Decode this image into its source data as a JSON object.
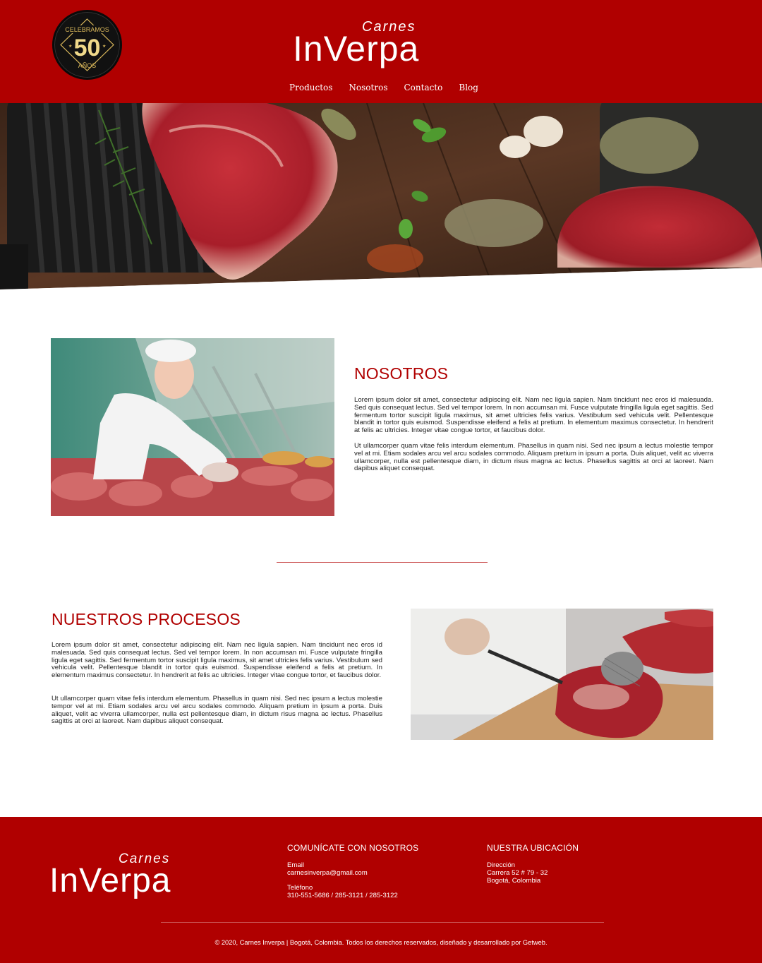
{
  "colors": {
    "brand_red": "#b00000",
    "white": "#ffffff",
    "gold": "#d8b65a"
  },
  "header": {
    "badge": {
      "top_text": "CELEBRAMOS",
      "number": "50",
      "bottom_text": "AÑOS"
    },
    "logo": {
      "small": "Carnes",
      "big": "InVerpa"
    },
    "nav": [
      "Productos",
      "Nosotros",
      "Contacto",
      "Blog"
    ]
  },
  "hero": {
    "image": "hero-meat-board-image"
  },
  "nosotros": {
    "title": "NOSOTROS",
    "image": "butcher-woman-counter-image",
    "p1": "Lorem ipsum dolor sit amet, consectetur adipiscing elit. Nam nec ligula sapien. Nam tincidunt nec eros id malesuada. Sed quis consequat lectus. Sed vel tempor lorem. In non accumsan mi. Fusce vulputate fringilla ligula eget sagittis. Sed fermentum tortor suscipit ligula maximus, sit amet ultricies felis varius. Vestibulum sed vehicula velit. Pellentesque blandit in tortor quis euismod. Suspendisse eleifend a felis at pretium. In elementum maximus consectetur. In hendrerit at felis ac ultricies. Integer vitae congue tortor, et faucibus dolor.",
    "p2": "Ut ullamcorper quam vitae felis interdum elementum. Phasellus in quam nisi. Sed nec ipsum a lectus molestie tempor vel at mi. Etiam sodales arcu vel arcu sodales commodo. Aliquam pretium in ipsum a porta. Duis aliquet, velit ac viverra ullamcorper, nulla est pellentesque diam, in dictum risus magna ac lectus. Phasellus sagittis at orci at laoreet. Nam dapibus aliquet consequat."
  },
  "procesos": {
    "title": "NUESTROS PROCESOS",
    "image": "butcher-cutting-meat-image",
    "p1": "Lorem ipsum dolor sit amet, consectetur adipiscing elit. Nam nec ligula sapien. Nam tincidunt nec eros id malesuada. Sed quis consequat lectus. Sed vel tempor lorem. In non accumsan mi. Fusce vulputate fringilla ligula eget sagittis. Sed fermentum tortor suscipit ligula maximus, sit amet ultricies felis varius. Vestibulum sed vehicula velit. Pellentesque blandit in tortor quis euismod. Suspendisse eleifend a felis at pretium. In elementum maximus consectetur. In hendrerit at felis ac ultricies. Integer vitae congue tortor, et faucibus dolor.",
    "p2": "Ut ullamcorper quam vitae felis interdum elementum. Phasellus in quam nisi. Sed nec ipsum a lectus molestie tempor vel at mi. Etiam sodales arcu vel arcu sodales commodo. Aliquam pretium in ipsum a porta. Duis aliquet, velit ac viverra ullamcorper, nulla est pellentesque diam, in dictum risus magna ac lectus. Phasellus sagittis at orci at laoreet. Nam dapibus aliquet consequat."
  },
  "footer": {
    "logo": {
      "small": "Carnes",
      "big": "InVerpa"
    },
    "contact": {
      "title": "COMUNÍCATE CON NOSOTROS",
      "email_label": "Email",
      "email": "carnesinverpa@gmail.com",
      "phone_label": "Teléfono",
      "phone": "310-551-5686 / 285-3121 / 285-3122"
    },
    "location": {
      "title": "NUESTRA UBICACIÓN",
      "label": "Dirección",
      "line1": "Carrera 52 # 79 - 32",
      "line2": "Bogotá, Colombia"
    },
    "copyright": "© 2020, Carnes Inverpa | Bogotá, Colombia. Todos los derechos reservados, diseñado y desarrollado por Getweb."
  }
}
